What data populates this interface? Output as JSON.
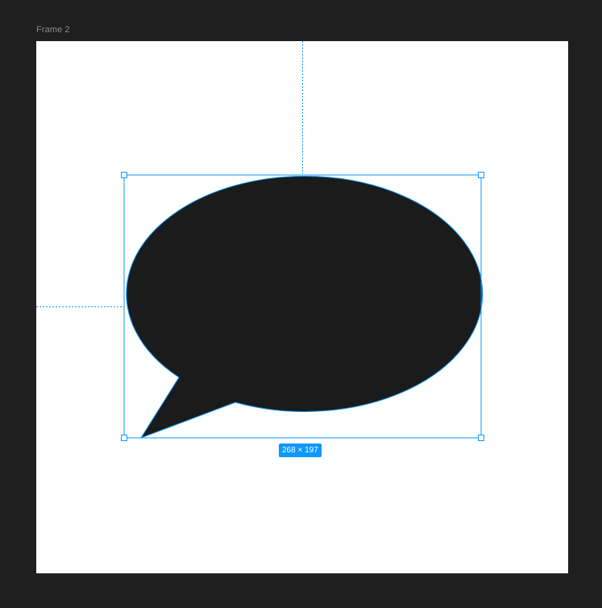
{
  "frame": {
    "name": "Frame 2"
  },
  "selection": {
    "size_label": "268 × 197",
    "shape_name": "speech-bubble",
    "fill_color": "#1b1b1b",
    "selection_color": "#0d99ff"
  },
  "colors": {
    "canvas_background": "#1f1f1f",
    "frame_background": "#ffffff",
    "frame_label": "#8a8a8a"
  }
}
